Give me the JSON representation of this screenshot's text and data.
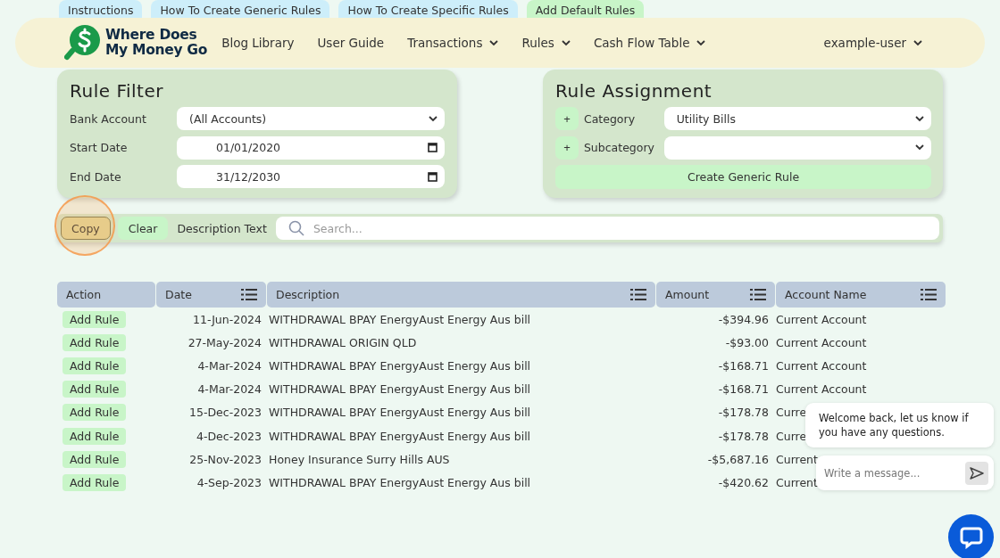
{
  "top_tabs": [
    {
      "label": "Instructions",
      "color": "#cdeefa"
    },
    {
      "label": "How To Create Generic Rules",
      "color": "#cdeefa"
    },
    {
      "label": "How To Create Specific Rules",
      "color": "#cdeefa"
    },
    {
      "label": "Add Default Rules",
      "color": "#c8f5c8"
    }
  ],
  "nav": {
    "logo_line_1": "Where Does",
    "logo_line_2": "My Money Go",
    "links": [
      {
        "label": "Blog Library",
        "dropdown": false
      },
      {
        "label": "User Guide",
        "dropdown": false
      },
      {
        "label": "Transactions",
        "dropdown": true
      },
      {
        "label": "Rules",
        "dropdown": true
      },
      {
        "label": "Cash Flow Table",
        "dropdown": true
      }
    ],
    "user": {
      "label": "example-user",
      "dropdown": true
    }
  },
  "rule_filter": {
    "title": "Rule Filter",
    "fields": [
      {
        "label": "Bank Account",
        "kind": "select",
        "value": "(All Accounts)"
      },
      {
        "label": "Start Date",
        "kind": "date",
        "value": "01/01/2020"
      },
      {
        "label": "End Date",
        "kind": "date",
        "value": "31/12/2030"
      }
    ]
  },
  "rule_assignment": {
    "title": "Rule Assignment",
    "fields": [
      {
        "add_button": "+",
        "label": "Category",
        "value": "Utility Bills"
      },
      {
        "add_button": "+",
        "label": "Subcategory"
      }
    ],
    "create_button": "Create Generic Rule"
  },
  "search_bar": {
    "buttons": [
      {
        "label": "Copy",
        "clicked": true
      },
      {
        "label": "Clear",
        "clicked": false
      }
    ],
    "label": "Description Text",
    "placeholder": "Search..."
  },
  "table": {
    "columns": [
      {
        "label": "Action",
        "menu": false
      },
      {
        "label": "Date",
        "menu": true
      },
      {
        "label": "Description",
        "menu": true
      },
      {
        "label": "Amount",
        "menu": true
      },
      {
        "label": "Account Name",
        "menu": true
      }
    ],
    "rows": [
      {
        "action": "Add Rule",
        "date": "11-Jun-2024",
        "description": "WITHDRAWAL BPAY EnergyAust Energy Aus bill",
        "amount": "-$394.96",
        "account": "Current Account"
      },
      {
        "action": "Add Rule",
        "date": "27-May-2024",
        "description": "WITHDRAWAL ORIGIN QLD",
        "amount": "-$93.00",
        "account": "Current Account"
      },
      {
        "action": "Add Rule",
        "date": "4-Mar-2024",
        "description": "WITHDRAWAL BPAY EnergyAust Energy Aus bill",
        "amount": "-$168.71",
        "account": "Current Account"
      },
      {
        "action": "Add Rule",
        "date": "4-Mar-2024",
        "description": "WITHDRAWAL BPAY EnergyAust Energy Aus bill",
        "amount": "-$168.71",
        "account": "Current Account"
      },
      {
        "action": "Add Rule",
        "date": "15-Dec-2023",
        "description": "WITHDRAWAL BPAY EnergyAust Energy Aus bill",
        "amount": "-$178.78",
        "account": "Curre"
      },
      {
        "action": "Add Rule",
        "date": "4-Dec-2023",
        "description": "WITHDRAWAL BPAY EnergyAust Energy Aus bill",
        "amount": "-$178.78",
        "account": "Curre"
      },
      {
        "action": "Add Rule",
        "date": "25-Nov-2023",
        "description": "Honey Insurance Surry Hills AUS",
        "amount": "-$5,687.16",
        "account": "Current"
      },
      {
        "action": "Add Rule",
        "date": "4-Sep-2023",
        "description": "WITHDRAWAL BPAY EnergyAust Energy Aus bill",
        "amount": "-$420.62",
        "account": "Current"
      }
    ]
  },
  "chat": {
    "message": "Welcome back, let us know if you have any questions.",
    "placeholder": "Write a message..."
  }
}
